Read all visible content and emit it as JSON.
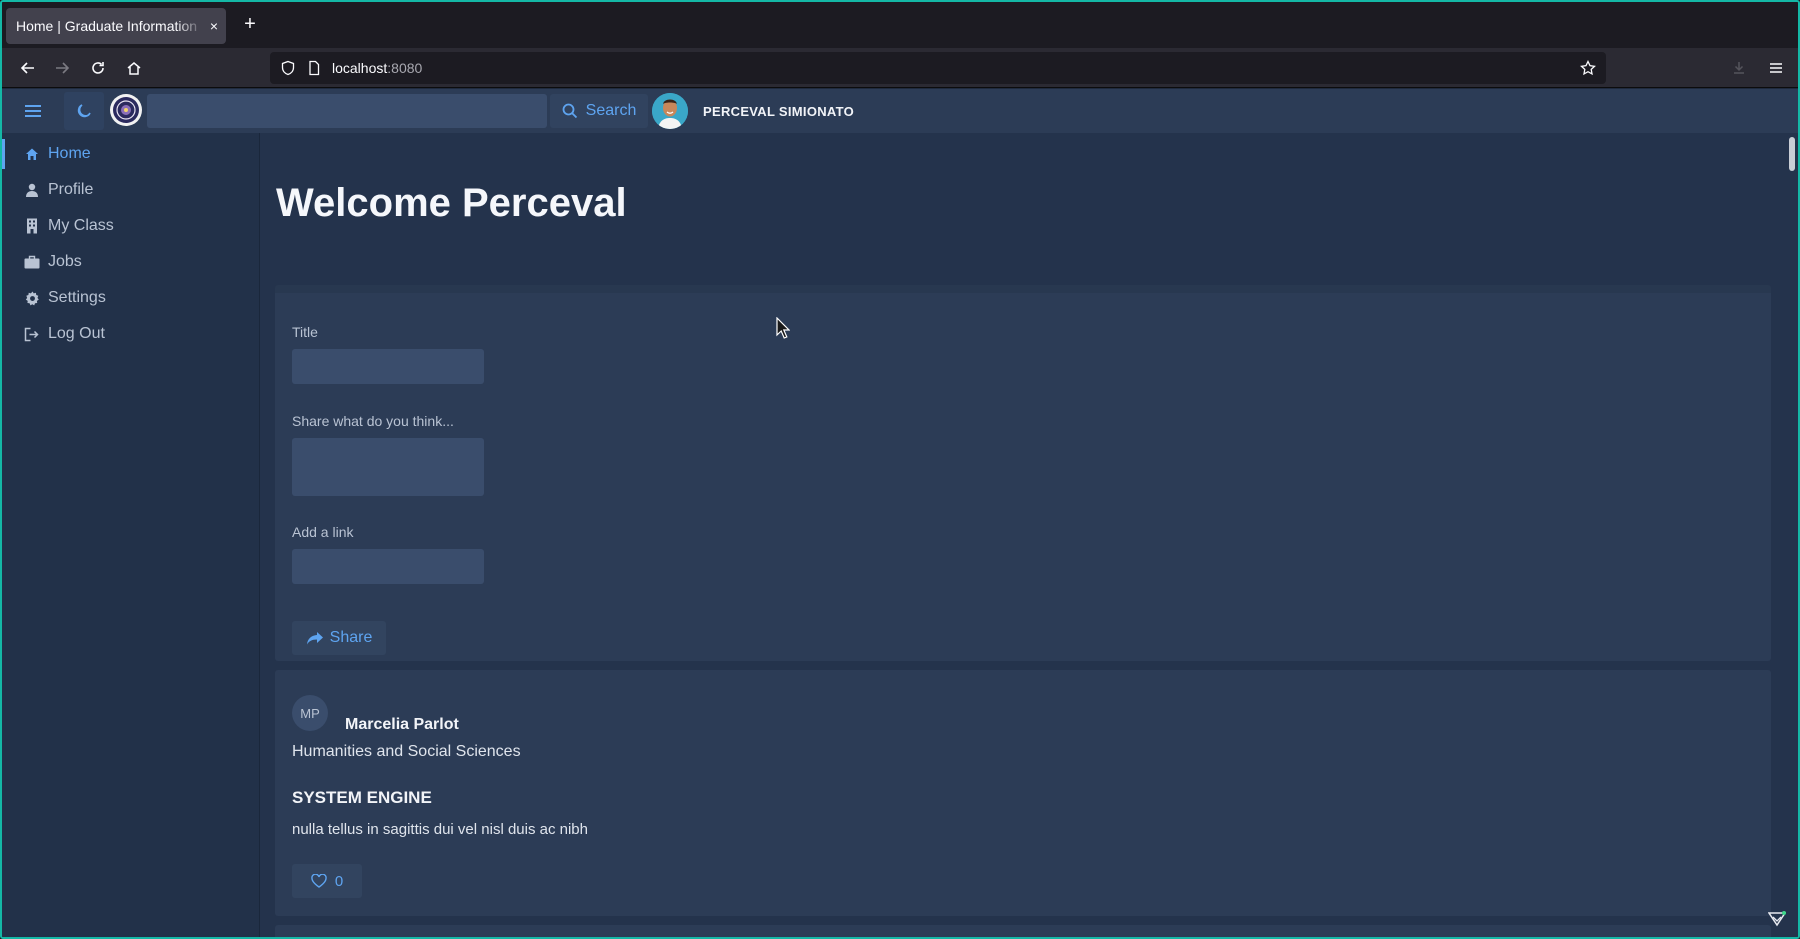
{
  "browser": {
    "tab_title": "Home | Graduate Information",
    "tab_close": "×",
    "new_tab": "+",
    "url_host": "localhost",
    "url_port": ":8080"
  },
  "header": {
    "search_placeholder": "",
    "search_label": "Search",
    "user_name": "PERCEVAL SIMIONATO"
  },
  "sidebar": {
    "items": [
      {
        "label": "Home",
        "icon": "home-icon",
        "active": true
      },
      {
        "label": "Profile",
        "icon": "user-icon",
        "active": false
      },
      {
        "label": "My Class",
        "icon": "building-icon",
        "active": false
      },
      {
        "label": "Jobs",
        "icon": "briefcase-icon",
        "active": false
      },
      {
        "label": "Settings",
        "icon": "gear-icon",
        "active": false
      },
      {
        "label": "Log Out",
        "icon": "logout-icon",
        "active": false
      }
    ]
  },
  "main": {
    "welcome": "Welcome Perceval",
    "form": {
      "title_label": "Title",
      "title_value": "",
      "thoughts_label": "Share what do you think...",
      "thoughts_value": "",
      "link_label": "Add a link",
      "link_value": "",
      "share_label": "Share"
    },
    "posts": [
      {
        "initials": "MP",
        "author": "Marcelia Parlot",
        "department": "Humanities and Social Sciences",
        "title": "SYSTEM ENGINE",
        "body": "nulla tellus in sagittis dui vel nisl duis ac nibh",
        "likes": "0"
      }
    ]
  },
  "colors": {
    "accent": "#5ea4f0",
    "background": "#24334c",
    "card": "#2c3c56",
    "frame_border": "#14b8a6"
  }
}
